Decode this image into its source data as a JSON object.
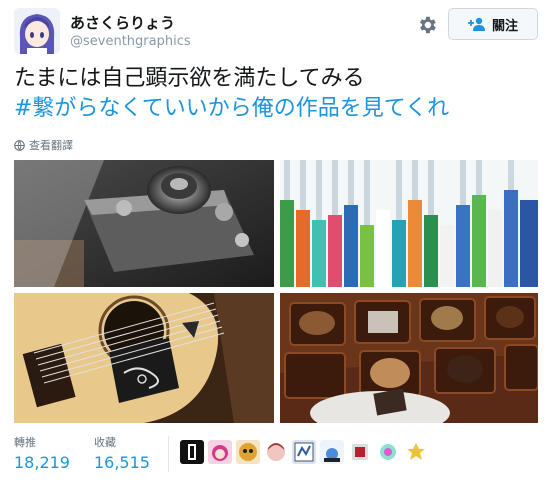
{
  "user": {
    "display_name": "あさくらりょう",
    "screen_name": "@seventhgraphics"
  },
  "actions": {
    "follow_label": "關注"
  },
  "tweet": {
    "line1": "たまには自己顕示欲を満たしてみる",
    "hashtag": "#繋がらなくていいから俺の作品を見てくれ"
  },
  "translate": {
    "label": "查看翻譯"
  },
  "photos": [
    {
      "subject": "vintage rangefinder camera"
    },
    {
      "subject": "rows of colorful pens"
    },
    {
      "subject": "acoustic guitar with pickguard"
    },
    {
      "subject": "box of chocolates"
    }
  ],
  "stats": {
    "retweets_label": "轉推",
    "retweets_value": "18,219",
    "likes_label": "收藏",
    "likes_value": "16,515"
  },
  "colors": {
    "link": "#1b95e0",
    "text": "#14171a",
    "muted": "#8899a6"
  },
  "icons": [
    "settings-gear-icon",
    "follow-person-plus-icon",
    "globe-icon"
  ]
}
